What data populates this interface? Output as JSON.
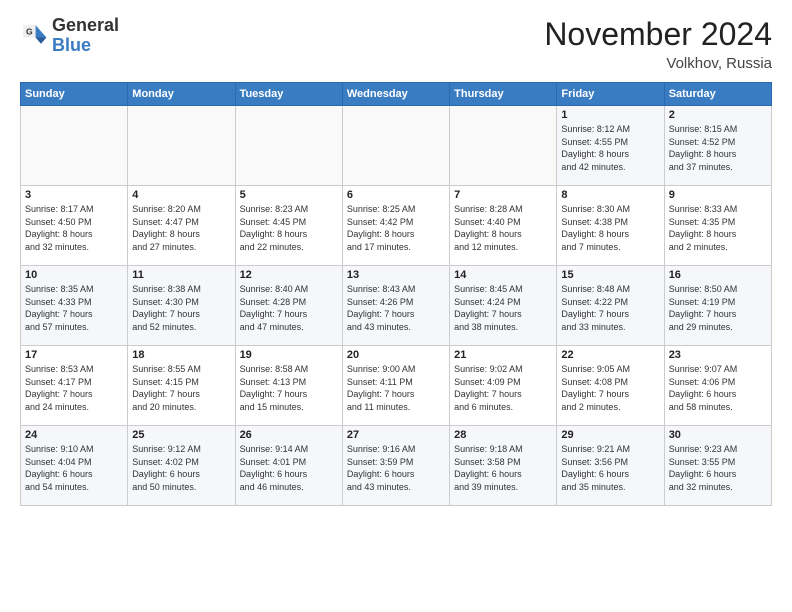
{
  "logo": {
    "general": "General",
    "blue": "Blue"
  },
  "header": {
    "title": "November 2024",
    "location": "Volkhov, Russia"
  },
  "weekdays": [
    "Sunday",
    "Monday",
    "Tuesday",
    "Wednesday",
    "Thursday",
    "Friday",
    "Saturday"
  ],
  "weeks": [
    [
      {
        "day": "",
        "info": ""
      },
      {
        "day": "",
        "info": ""
      },
      {
        "day": "",
        "info": ""
      },
      {
        "day": "",
        "info": ""
      },
      {
        "day": "",
        "info": ""
      },
      {
        "day": "1",
        "info": "Sunrise: 8:12 AM\nSunset: 4:55 PM\nDaylight: 8 hours\nand 42 minutes."
      },
      {
        "day": "2",
        "info": "Sunrise: 8:15 AM\nSunset: 4:52 PM\nDaylight: 8 hours\nand 37 minutes."
      }
    ],
    [
      {
        "day": "3",
        "info": "Sunrise: 8:17 AM\nSunset: 4:50 PM\nDaylight: 8 hours\nand 32 minutes."
      },
      {
        "day": "4",
        "info": "Sunrise: 8:20 AM\nSunset: 4:47 PM\nDaylight: 8 hours\nand 27 minutes."
      },
      {
        "day": "5",
        "info": "Sunrise: 8:23 AM\nSunset: 4:45 PM\nDaylight: 8 hours\nand 22 minutes."
      },
      {
        "day": "6",
        "info": "Sunrise: 8:25 AM\nSunset: 4:42 PM\nDaylight: 8 hours\nand 17 minutes."
      },
      {
        "day": "7",
        "info": "Sunrise: 8:28 AM\nSunset: 4:40 PM\nDaylight: 8 hours\nand 12 minutes."
      },
      {
        "day": "8",
        "info": "Sunrise: 8:30 AM\nSunset: 4:38 PM\nDaylight: 8 hours\nand 7 minutes."
      },
      {
        "day": "9",
        "info": "Sunrise: 8:33 AM\nSunset: 4:35 PM\nDaylight: 8 hours\nand 2 minutes."
      }
    ],
    [
      {
        "day": "10",
        "info": "Sunrise: 8:35 AM\nSunset: 4:33 PM\nDaylight: 7 hours\nand 57 minutes."
      },
      {
        "day": "11",
        "info": "Sunrise: 8:38 AM\nSunset: 4:30 PM\nDaylight: 7 hours\nand 52 minutes."
      },
      {
        "day": "12",
        "info": "Sunrise: 8:40 AM\nSunset: 4:28 PM\nDaylight: 7 hours\nand 47 minutes."
      },
      {
        "day": "13",
        "info": "Sunrise: 8:43 AM\nSunset: 4:26 PM\nDaylight: 7 hours\nand 43 minutes."
      },
      {
        "day": "14",
        "info": "Sunrise: 8:45 AM\nSunset: 4:24 PM\nDaylight: 7 hours\nand 38 minutes."
      },
      {
        "day": "15",
        "info": "Sunrise: 8:48 AM\nSunset: 4:22 PM\nDaylight: 7 hours\nand 33 minutes."
      },
      {
        "day": "16",
        "info": "Sunrise: 8:50 AM\nSunset: 4:19 PM\nDaylight: 7 hours\nand 29 minutes."
      }
    ],
    [
      {
        "day": "17",
        "info": "Sunrise: 8:53 AM\nSunset: 4:17 PM\nDaylight: 7 hours\nand 24 minutes."
      },
      {
        "day": "18",
        "info": "Sunrise: 8:55 AM\nSunset: 4:15 PM\nDaylight: 7 hours\nand 20 minutes."
      },
      {
        "day": "19",
        "info": "Sunrise: 8:58 AM\nSunset: 4:13 PM\nDaylight: 7 hours\nand 15 minutes."
      },
      {
        "day": "20",
        "info": "Sunrise: 9:00 AM\nSunset: 4:11 PM\nDaylight: 7 hours\nand 11 minutes."
      },
      {
        "day": "21",
        "info": "Sunrise: 9:02 AM\nSunset: 4:09 PM\nDaylight: 7 hours\nand 6 minutes."
      },
      {
        "day": "22",
        "info": "Sunrise: 9:05 AM\nSunset: 4:08 PM\nDaylight: 7 hours\nand 2 minutes."
      },
      {
        "day": "23",
        "info": "Sunrise: 9:07 AM\nSunset: 4:06 PM\nDaylight: 6 hours\nand 58 minutes."
      }
    ],
    [
      {
        "day": "24",
        "info": "Sunrise: 9:10 AM\nSunset: 4:04 PM\nDaylight: 6 hours\nand 54 minutes."
      },
      {
        "day": "25",
        "info": "Sunrise: 9:12 AM\nSunset: 4:02 PM\nDaylight: 6 hours\nand 50 minutes."
      },
      {
        "day": "26",
        "info": "Sunrise: 9:14 AM\nSunset: 4:01 PM\nDaylight: 6 hours\nand 46 minutes."
      },
      {
        "day": "27",
        "info": "Sunrise: 9:16 AM\nSunset: 3:59 PM\nDaylight: 6 hours\nand 43 minutes."
      },
      {
        "day": "28",
        "info": "Sunrise: 9:18 AM\nSunset: 3:58 PM\nDaylight: 6 hours\nand 39 minutes."
      },
      {
        "day": "29",
        "info": "Sunrise: 9:21 AM\nSunset: 3:56 PM\nDaylight: 6 hours\nand 35 minutes."
      },
      {
        "day": "30",
        "info": "Sunrise: 9:23 AM\nSunset: 3:55 PM\nDaylight: 6 hours\nand 32 minutes."
      }
    ]
  ]
}
